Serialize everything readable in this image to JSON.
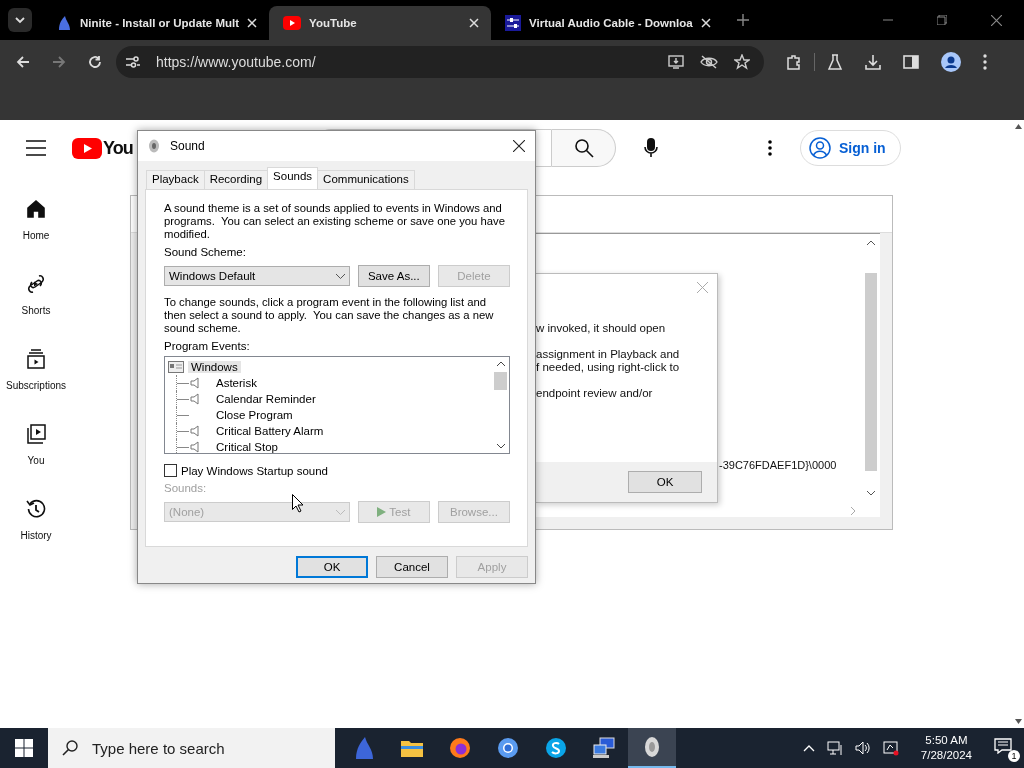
{
  "browser": {
    "tabs": [
      {
        "title": "Ninite - Install or Update Mult",
        "kind": "ninite",
        "selected": false
      },
      {
        "title": "YouTube",
        "kind": "youtube",
        "selected": true
      },
      {
        "title": "Virtual Audio Cable - Downloa",
        "kind": "vac",
        "selected": false
      }
    ],
    "url": "https://www.youtube.com/"
  },
  "youtube": {
    "logo_text": "You",
    "sign_in": "Sign in",
    "nav": [
      {
        "label": "Home",
        "kind": "home"
      },
      {
        "label": "Shorts",
        "kind": "shorts"
      },
      {
        "label": "Subscriptions",
        "kind": "subscriptions"
      },
      {
        "label": "You",
        "kind": "you"
      },
      {
        "label": "History",
        "kind": "history"
      }
    ]
  },
  "background_window": {
    "code_text": "-39C76FDAEF1D}\\0000",
    "dialog": {
      "paragraphs": [
        {
          "lines": [
            "w invoked, it should open"
          ]
        },
        {
          "lines": [
            "assignment in Playback and",
            "f needed, using right-click to"
          ]
        },
        {
          "lines": [
            "endpoint review and/or"
          ]
        }
      ],
      "ok": "OK"
    }
  },
  "sound_dialog": {
    "title": "Sound",
    "tabs": [
      {
        "label": "Playback",
        "selected": false
      },
      {
        "label": "Recording",
        "selected": false
      },
      {
        "label": "Sounds",
        "selected": true
      },
      {
        "label": "Communications",
        "selected": false
      }
    ],
    "intro": "A sound theme is a set of sounds applied to events in Windows and programs.  You can select an existing scheme or save one you have modified.",
    "scheme_label": "Sound Scheme:",
    "scheme_value": "Windows Default",
    "scheme_buttons": [
      {
        "label": "Save As...",
        "disabled": false
      },
      {
        "label": "Delete",
        "disabled": true
      }
    ],
    "change_text": "To change sounds, click a program event in the following list and then select a sound to apply.  You can save the changes as a new sound scheme.",
    "events_label": "Program Events:",
    "events": [
      {
        "label": "Windows",
        "children": [
          {
            "label": "Asterisk",
            "sound": true
          },
          {
            "label": "Calendar Reminder",
            "sound": true
          },
          {
            "label": "Close Program",
            "sound": false
          },
          {
            "label": "Critical Battery Alarm",
            "sound": true
          },
          {
            "label": "Critical Stop",
            "sound": true
          }
        ]
      }
    ],
    "startup": {
      "label": "Play Windows Startup sound",
      "checked": false
    },
    "sounds_label": "Sounds:",
    "sounds_disabled": true,
    "sound_value": "(None)",
    "sound_buttons": [
      {
        "label": "Test",
        "kind": "play",
        "disabled": true
      },
      {
        "label": "Browse...",
        "kind": "plain",
        "disabled": true
      }
    ],
    "buttons": [
      {
        "label": "OK",
        "default": true,
        "disabled": false
      },
      {
        "label": "Cancel",
        "default": false,
        "disabled": false
      },
      {
        "label": "Apply",
        "default": false,
        "disabled": true
      }
    ]
  },
  "taskbar": {
    "search_placeholder": "Type here to search",
    "apps": [
      {
        "kind": "ninite",
        "selected": false
      },
      {
        "kind": "folder",
        "selected": false
      },
      {
        "kind": "firefox",
        "selected": false
      },
      {
        "kind": "chrome",
        "selected": false
      },
      {
        "kind": "skype",
        "selected": false
      },
      {
        "kind": "network",
        "selected": false
      },
      {
        "kind": "sound",
        "selected": true
      }
    ],
    "time": "5:50 AM",
    "date": "7/28/2024",
    "notifications": "1"
  }
}
